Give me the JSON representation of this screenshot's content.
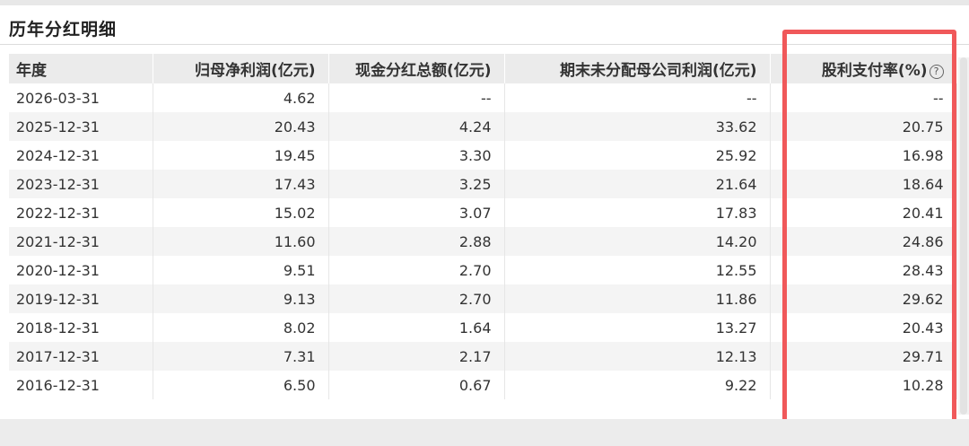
{
  "section": {
    "title": "历年分红明细"
  },
  "table": {
    "headers": {
      "year": "年度",
      "net_profit": "归母净利润(亿元)",
      "cash_dividend": "现金分红总额(亿元)",
      "retained_profit": "期末未分配母公司利润(亿元)",
      "payout_ratio": "股利支付率(%)"
    },
    "rows": [
      {
        "year": "2026-03-31",
        "net_profit": "4.62",
        "cash_dividend": "--",
        "retained_profit": "--",
        "payout_ratio": "--"
      },
      {
        "year": "2025-12-31",
        "net_profit": "20.43",
        "cash_dividend": "4.24",
        "retained_profit": "33.62",
        "payout_ratio": "20.75"
      },
      {
        "year": "2024-12-31",
        "net_profit": "19.45",
        "cash_dividend": "3.30",
        "retained_profit": "25.92",
        "payout_ratio": "16.98"
      },
      {
        "year": "2023-12-31",
        "net_profit": "17.43",
        "cash_dividend": "3.25",
        "retained_profit": "21.64",
        "payout_ratio": "18.64"
      },
      {
        "year": "2022-12-31",
        "net_profit": "15.02",
        "cash_dividend": "3.07",
        "retained_profit": "17.83",
        "payout_ratio": "20.41"
      },
      {
        "year": "2021-12-31",
        "net_profit": "11.60",
        "cash_dividend": "2.88",
        "retained_profit": "14.20",
        "payout_ratio": "24.86"
      },
      {
        "year": "2020-12-31",
        "net_profit": "9.51",
        "cash_dividend": "2.70",
        "retained_profit": "12.55",
        "payout_ratio": "28.43"
      },
      {
        "year": "2019-12-31",
        "net_profit": "9.13",
        "cash_dividend": "2.70",
        "retained_profit": "11.86",
        "payout_ratio": "29.62"
      },
      {
        "year": "2018-12-31",
        "net_profit": "8.02",
        "cash_dividend": "1.64",
        "retained_profit": "13.27",
        "payout_ratio": "20.43"
      },
      {
        "year": "2017-12-31",
        "net_profit": "7.31",
        "cash_dividend": "2.17",
        "retained_profit": "12.13",
        "payout_ratio": "29.71"
      },
      {
        "year": "2016-12-31",
        "net_profit": "6.50",
        "cash_dividend": "0.67",
        "retained_profit": "9.22",
        "payout_ratio": "10.28"
      }
    ]
  },
  "icons": {
    "help": "question-circle-icon"
  },
  "colors": {
    "highlight": "#f0585a",
    "header_bg": "#ebebeb",
    "stripe_bg": "#f4f4f4"
  }
}
